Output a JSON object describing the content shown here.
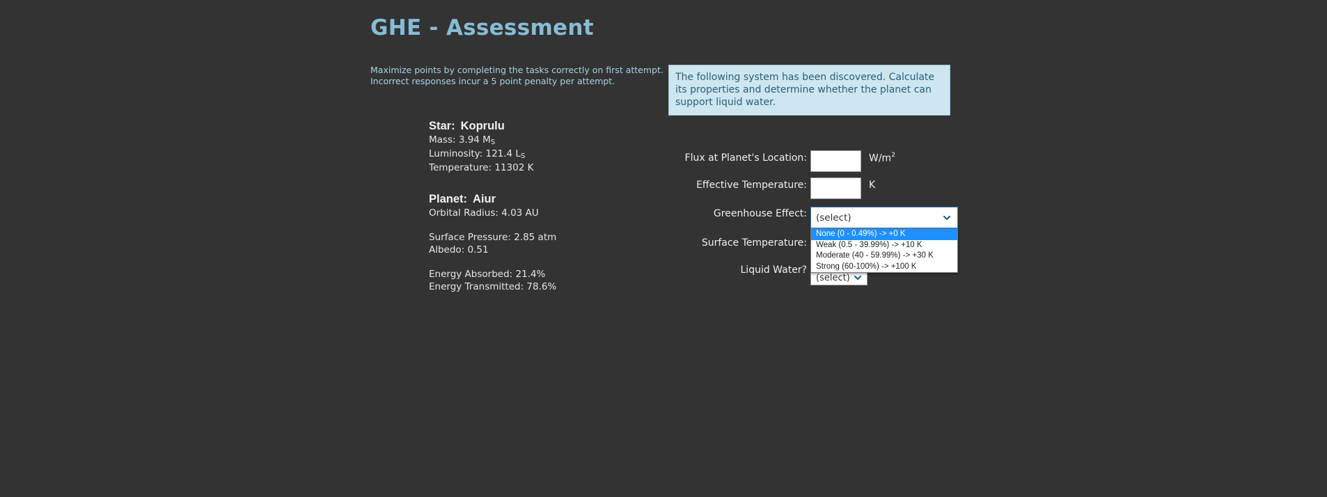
{
  "title": "GHE - Assessment",
  "instructions": {
    "line1": "Maximize points by completing the tasks correctly on first attempt.",
    "line2": "Incorrect responses incur a 5 point penalty per attempt."
  },
  "notice": "The following system has been discovered.  Calculate its properties and determine whether the planet can support liquid water.",
  "star": {
    "label": "Star:",
    "name": "Koprulu",
    "mass_label": "Mass:  3.94 M",
    "mass_sub": "S",
    "luminosity_label": "Luminosity:  121.4 L",
    "luminosity_sub": "S",
    "temperature": "Temperature:  11302 K"
  },
  "planet": {
    "label": "Planet:",
    "name": "Aiur",
    "orbital_radius": "Orbital Radius:  4.03 AU",
    "surface_pressure": "Surface Pressure:  2.85 atm",
    "albedo": "Albedo:  0.51",
    "energy_absorbed": "Energy Absorbed: 21.4%",
    "energy_transmitted": "Energy Transmitted: 78.6%"
  },
  "form": {
    "flux_label": "Flux at Planet's Location:",
    "flux_value": "",
    "flux_unit": "W/m",
    "flux_unit_sup": "2",
    "eff_temp_label": "Effective Temperature:",
    "eff_temp_value": "",
    "eff_temp_unit": "K",
    "greenhouse_label": "Greenhouse Effect:",
    "greenhouse_selected": "(select)",
    "surface_temp_label": "Surface Temperature:",
    "liquid_water_label": "Liquid Water?",
    "liquid_water_selected": "(select)"
  },
  "greenhouse_options": [
    "None (0 - 0.49%) -> +0 K",
    "Weak (0.5 - 39.99%) -> +10 K",
    "Moderate (40 - 59.99%) -> +30 K",
    "Strong (60-100%) -> +100 K"
  ],
  "highlighted_option_index": 0,
  "colors": {
    "background": "#333333",
    "title": "#86bcd5",
    "notice_bg": "#cde6f0",
    "notice_text": "#2c5e7a",
    "option_highlight": "#1e90ff"
  }
}
